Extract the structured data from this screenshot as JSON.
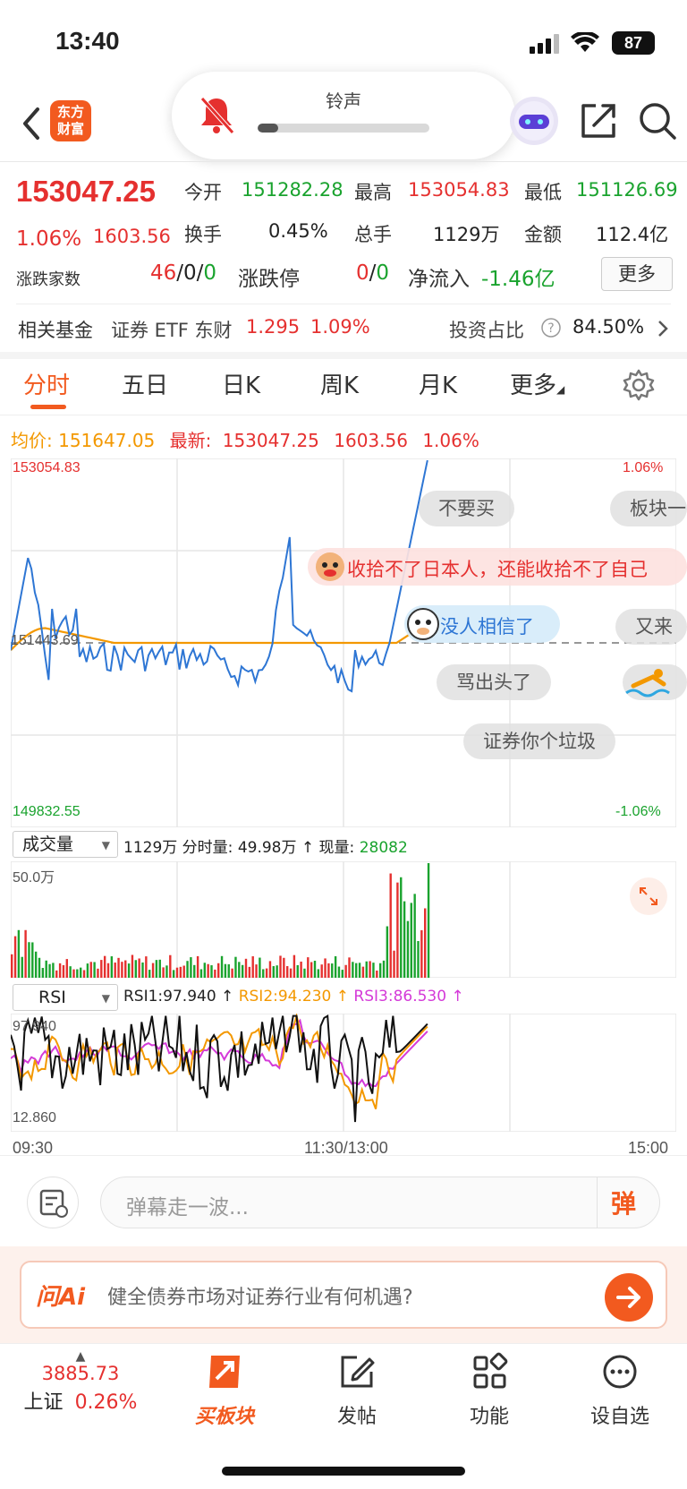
{
  "status_bar": {
    "time": "13:40",
    "battery": "87"
  },
  "header": {
    "logo_line1": "东方",
    "logo_line2": "财富",
    "ringer_title": "铃声",
    "ringer_level": 0.12
  },
  "quote": {
    "price": "153047.25",
    "change_pct": "1.06%",
    "change": "1603.56",
    "open_label": "今开",
    "open": "151282.28",
    "high_label": "最高",
    "high": "153054.83",
    "low_label": "最低",
    "low": "151126.69",
    "turnover_label": "换手",
    "turnover": "0.45%",
    "volume_label": "总手",
    "volume": "1129万",
    "amount_label": "金额",
    "amount": "112.4亿",
    "updown_label": "涨跌家数",
    "up_count": "46",
    "flat_count": "0",
    "down_count": "0",
    "limit_label": "涨跌停",
    "limit_up": "0",
    "limit_down": "0",
    "inflow_label": "净流入",
    "inflow": "-1.46亿",
    "more_button": "更多"
  },
  "fund": {
    "label": "相关基金",
    "name": "证券 ETF 东财",
    "price": "1.295",
    "change_pct": "1.09%",
    "ratio_label": "投资占比",
    "ratio": "84.50%"
  },
  "tabs": [
    "分时",
    "五日",
    "日K",
    "周K",
    "月K",
    "更多"
  ],
  "intraday": {
    "avg_label": "均价:",
    "avg": "151647.05",
    "latest_label": "最新:",
    "latest": "153047.25",
    "latest_change": "1603.56",
    "latest_pct": "1.06%",
    "y_max": "153054.83",
    "y_mid": "151443.69",
    "y_min": "149832.55",
    "pct_max": "1.06%",
    "pct_min": "-1.06%"
  },
  "danmaku": [
    "不要买",
    "板块一",
    "收拾不了日本人，还能收拾不了自己",
    "没人相信了",
    "又来",
    "骂出头了",
    "证券你个垃圾"
  ],
  "volume_panel": {
    "selector": "成交量",
    "total": "1129万",
    "minute_label": "分时量:",
    "minute_value": "49.98万",
    "current_label": "现量:",
    "current_value": "28082",
    "y_max": "50.0万"
  },
  "rsi_panel": {
    "selector": "RSI",
    "rsi1": "RSI1:97.940 ↑",
    "rsi2": "RSI2:94.230 ↑",
    "rsi3": "RSI3:86.530 ↑",
    "y_max": "97.940",
    "y_min": "12.860"
  },
  "time_axis": {
    "start": "09:30",
    "mid": "11:30/13:00",
    "end": "15:00"
  },
  "danmu_input": {
    "placeholder": "弹幕走一波...",
    "send_label": "弹"
  },
  "ai_bar": {
    "brand": "问Ai",
    "question": "健全债券市场对证券行业有何机遇?"
  },
  "bottom_nav": {
    "index_value": "3885.73",
    "index_name": "上证",
    "index_pct": "0.26%",
    "items": [
      "买板块",
      "发帖",
      "功能",
      "设自选"
    ]
  },
  "colors": {
    "up": "#e5302f",
    "down": "#1aa32e",
    "accent": "#f25a1f",
    "avg_line": "#f39800",
    "price_line": "#2e76d4"
  }
}
